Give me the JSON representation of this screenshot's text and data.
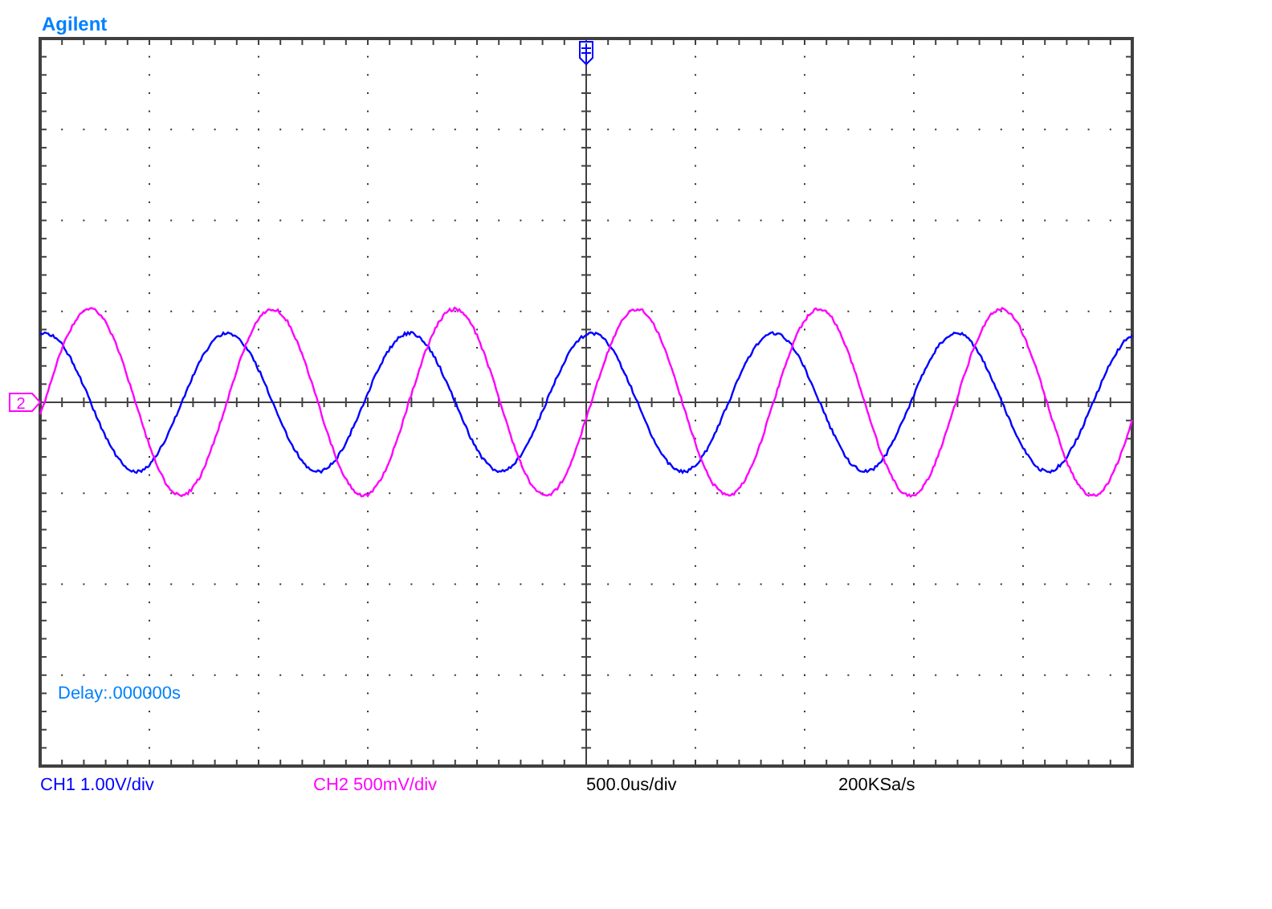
{
  "brand": "Agilent",
  "delay": "Delay:.000000s",
  "channels": [
    {
      "label": "CH1 1.00V/div",
      "color": "#0000ff"
    },
    {
      "label": "CH2 500mV/div",
      "color": "#ff00ff",
      "ground_marker": "2"
    }
  ],
  "timebase": "500.0us/div",
  "sample_rate": "200KSa/s"
}
